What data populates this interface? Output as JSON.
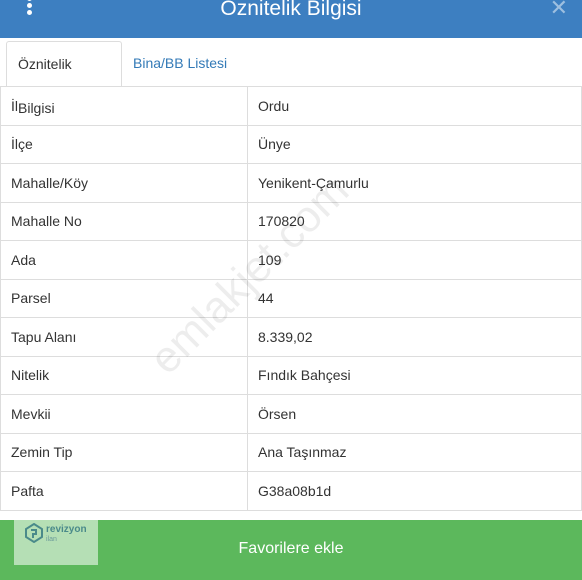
{
  "header": {
    "title": "Öznitelik Bilgisi",
    "close_glyph": "✕",
    "menu_icon": "vertical-dots-icon"
  },
  "tabs": [
    {
      "label": "Öznitelik Bilgisi",
      "active": true
    },
    {
      "label": "Bina/BB Listesi",
      "active": false
    }
  ],
  "attributes": [
    {
      "key": "İl",
      "value": "Ordu"
    },
    {
      "key": "İlçe",
      "value": "Ünye"
    },
    {
      "key": "Mahalle/Köy",
      "value": "Yenikent-Çamurlu"
    },
    {
      "key": "Mahalle No",
      "value": "170820"
    },
    {
      "key": "Ada",
      "value": "109"
    },
    {
      "key": "Parsel",
      "value": "44"
    },
    {
      "key": "Tapu Alanı",
      "value": "8.339,02"
    },
    {
      "key": "Nitelik",
      "value": "Fındık Bahçesi"
    },
    {
      "key": "Mevkii",
      "value": "Örsen"
    },
    {
      "key": "Zemin Tip",
      "value": "Ana Taşınmaz"
    },
    {
      "key": "Pafta",
      "value": "G38a08b1d"
    }
  ],
  "footer": {
    "button_label": "Favorilere ekle"
  },
  "logo": {
    "brand": "revizyon",
    "sub": "ilan"
  },
  "watermark": "emlakjet.com",
  "colors": {
    "header": "#3d7fc1",
    "footer": "#5cb85c",
    "link": "#337ab7"
  }
}
